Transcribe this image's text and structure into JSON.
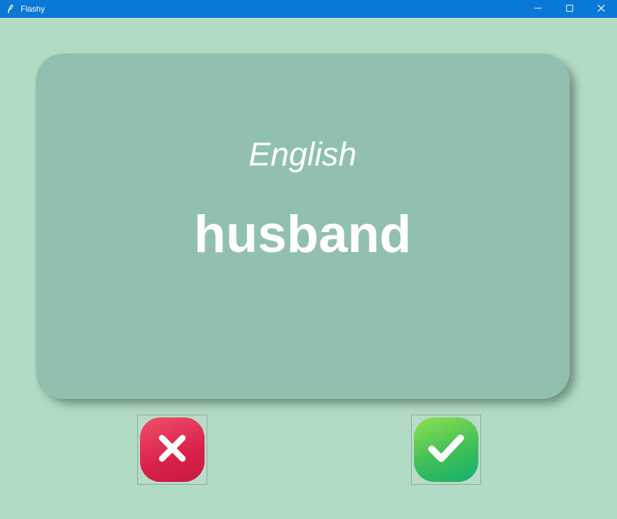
{
  "window": {
    "title": "Flashy",
    "controls": [
      "minimize-icon",
      "maximize-icon",
      "close-icon"
    ]
  },
  "card": {
    "title": "English",
    "word": "husband"
  },
  "buttons": {
    "wrong": {
      "icon": "cross-icon",
      "color": "#e0294f"
    },
    "right": {
      "icon": "checkmark-icon",
      "color": "#3fc05a"
    }
  },
  "colors": {
    "background": "#b1dbc5",
    "card": "#91c1ae",
    "titlebar": "#0a78d7"
  }
}
